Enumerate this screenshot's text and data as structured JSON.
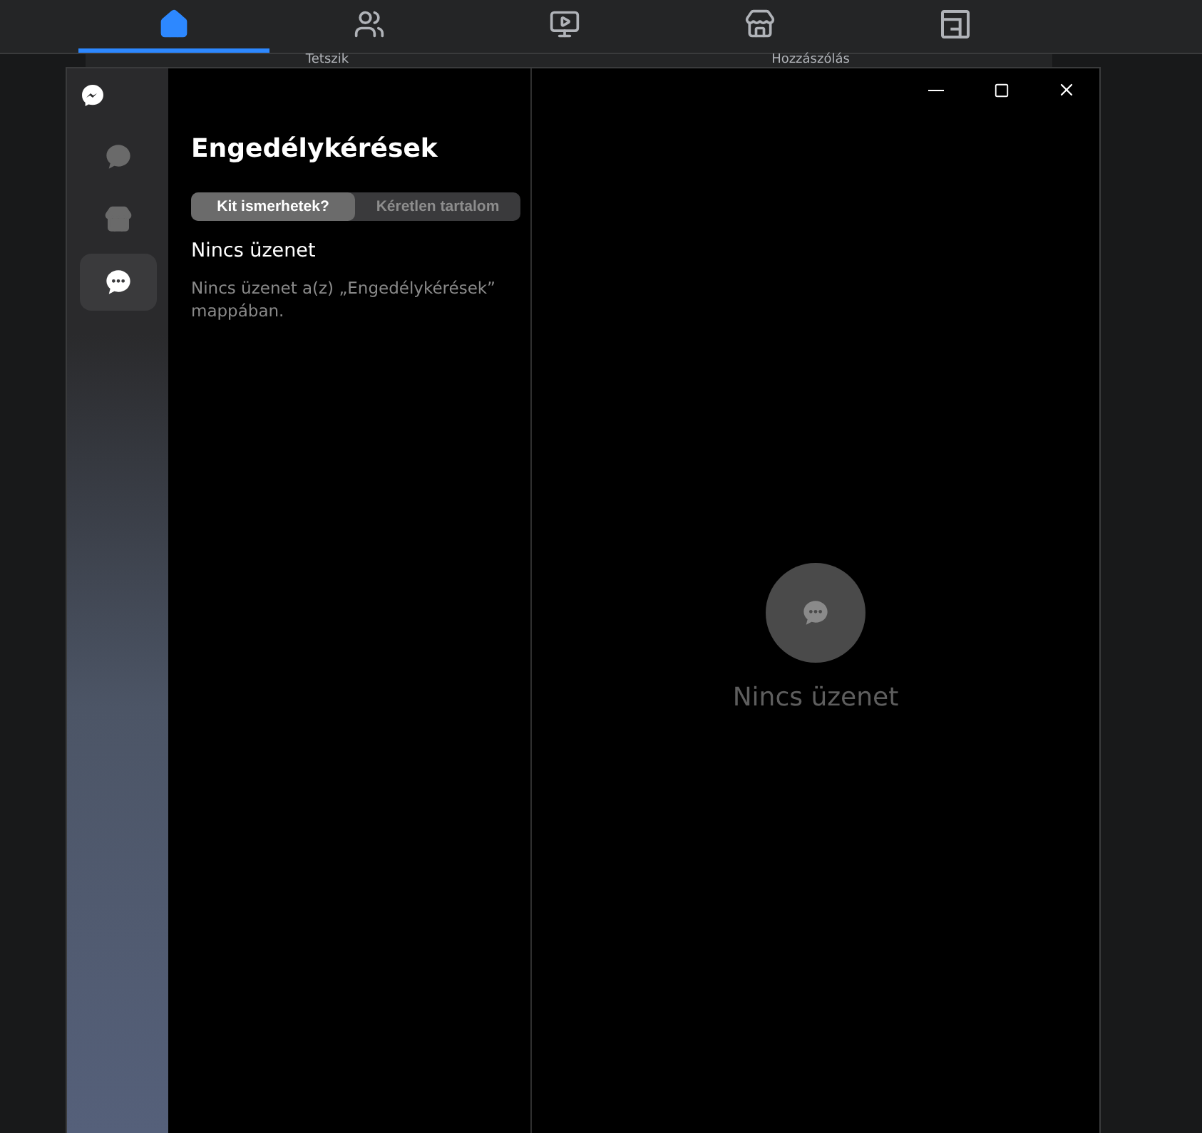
{
  "background_page": {
    "nav_tabs": [
      {
        "selected": true
      },
      {
        "selected": false
      },
      {
        "selected": false
      },
      {
        "selected": false
      },
      {
        "selected": false
      }
    ],
    "post_actions": [
      "Tetszik",
      "Hozzászólás"
    ]
  },
  "rail": {
    "items": [
      {
        "selected": false
      },
      {
        "selected": false
      },
      {
        "selected": true
      }
    ]
  },
  "list_panel": {
    "title": "Engedélykérések",
    "tabs": [
      {
        "label": "Kit ismerhetek?",
        "selected": true
      },
      {
        "label": "Kéretlen tartalom",
        "selected": false
      }
    ],
    "empty_title": "Nincs üzenet",
    "empty_text": "Nincs üzenet a(z) „Engedélykérések” mappában."
  },
  "main": {
    "empty_label": "Nincs üzenet"
  }
}
